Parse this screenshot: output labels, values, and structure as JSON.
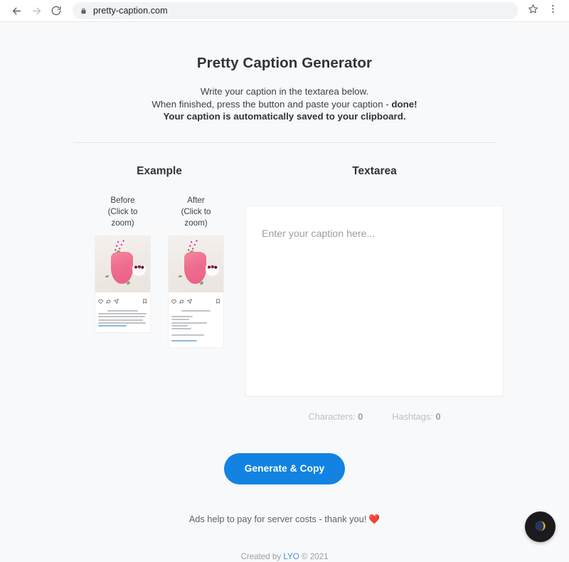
{
  "browser": {
    "back_icon": "arrow-left-icon",
    "forward_icon": "arrow-right-icon",
    "reload_icon": "reload-icon",
    "lock_icon": "lock-icon",
    "url": "pretty-caption.com",
    "bookmark_icon": "star-icon",
    "menu_icon": "three-dot-menu-icon"
  },
  "header": {
    "title": "Pretty Caption Generator",
    "line1": "Write your caption in the textarea below.",
    "line2_prefix": "When finished, press the button and paste your caption - ",
    "line2_bold": "done!",
    "line3": "Your caption is automatically saved to your clipboard."
  },
  "example": {
    "section_title": "Example",
    "before": {
      "label_line1": "Before",
      "label_line2": "(Click to",
      "label_line3": "zoom)",
      "alt": "instagram-post-before-thumbnail"
    },
    "after": {
      "label_line1": "After",
      "label_line2": "(Click to",
      "label_line3": "zoom)",
      "alt": "instagram-post-after-thumbnail"
    }
  },
  "textarea_panel": {
    "section_title": "Textarea",
    "placeholder": "Enter your caption here...",
    "value": "",
    "counters": {
      "characters_label": "Characters:",
      "characters_value": "0",
      "hashtags_label": "Hashtags:",
      "hashtags_value": "0"
    }
  },
  "actions": {
    "generate_label": "Generate & Copy",
    "generate_color": "#1283e2"
  },
  "footer": {
    "ads_note": "Ads help to pay for server costs - thank you!",
    "heart": "❤️",
    "created_prefix": "Created by ",
    "created_author": "LYO",
    "created_suffix": " © 2021",
    "author_color": "#4a90d9"
  },
  "theme_toggle": {
    "icon": "half-moon-icon",
    "background": "#1b1b1d",
    "moon_light": "#f5c518",
    "moon_dark": "#27355e"
  }
}
